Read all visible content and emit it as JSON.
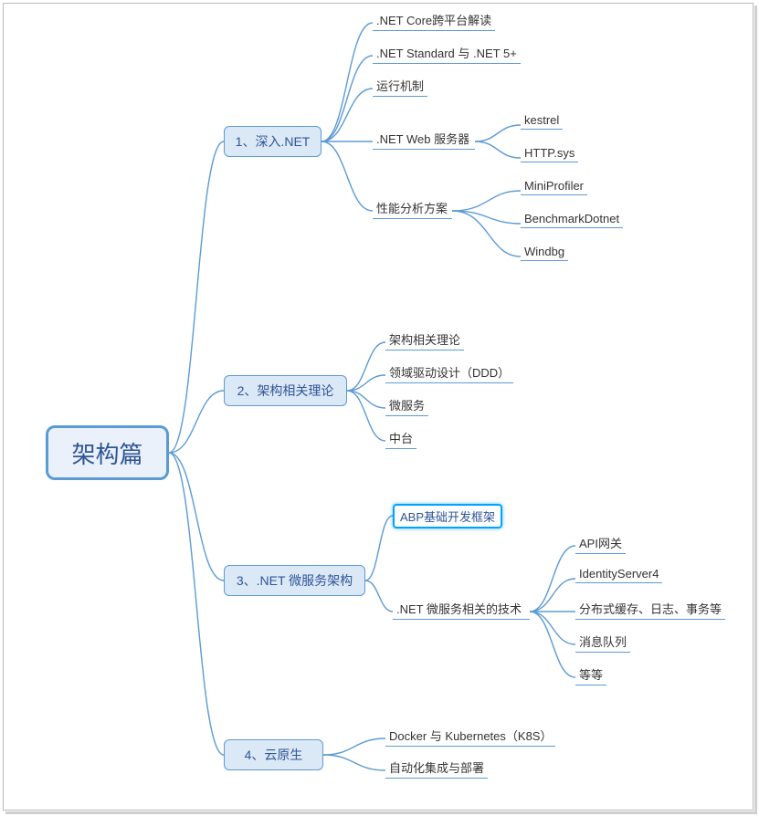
{
  "root": "架构篇",
  "branches": {
    "b1": "1、深入.NET",
    "b2": "2、架构相关理论",
    "b3": "3、.NET 微服务架构",
    "b4": "4、云原生"
  },
  "leaves": {
    "l1_1": ".NET Core跨平台解读",
    "l1_2": ".NET Standard 与 .NET 5+",
    "l1_3": "运行机制",
    "l1_4": ".NET Web 服务器",
    "l1_4a": "kestrel",
    "l1_4b": "HTTP.sys",
    "l1_5": "性能分析方案",
    "l1_5a": "MiniProfiler",
    "l1_5b": "BenchmarkDotnet",
    "l1_5c": "Windbg",
    "l2_1": "架构相关理论",
    "l2_2": "领域驱动设计（DDD）",
    "l2_3": "微服务",
    "l2_4": "中台",
    "l3_1": "ABP基础开发框架",
    "l3_2": ".NET 微服务相关的技术",
    "l3_2a": "API网关",
    "l3_2b": "IdentityServer4",
    "l3_2c": "分布式缓存、日志、事务等",
    "l3_2d": "消息队列",
    "l3_2e": "等等",
    "l4_1": "Docker 与 Kubernetes（K8S）",
    "l4_2": "自动化集成与部署"
  },
  "colors": {
    "line": "#5B9BD5"
  }
}
